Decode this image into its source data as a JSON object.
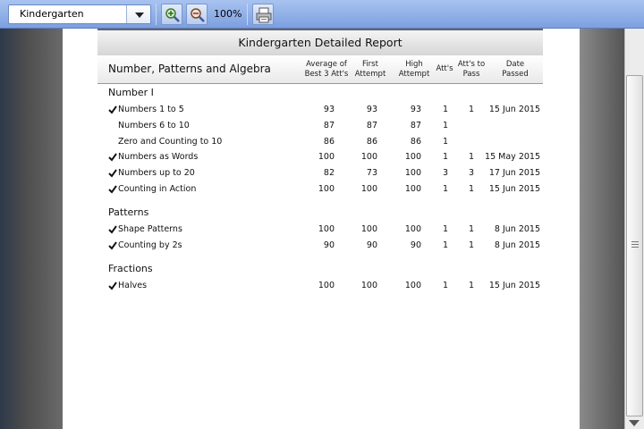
{
  "toolbar": {
    "dropdown_value": "Kindergarten",
    "zoom": "100%",
    "icons": {
      "zoom_in": "zoom-in-icon",
      "zoom_out": "zoom-out-icon",
      "print": "printer-icon"
    }
  },
  "report": {
    "title": "Kindergarten Detailed Report",
    "section": "Number, Patterns and Algebra",
    "columns": {
      "avg": "Average of Best 3 Att's",
      "first": "First Attempt",
      "high": "High Attempt",
      "atts": "Att's",
      "atts_to_pass": "Att's to Pass",
      "date_passed": "Date Passed"
    },
    "groups": [
      {
        "name": "Number I",
        "rows": [
          {
            "passed": true,
            "name": "Numbers 1 to 5",
            "avg": "93",
            "first": "93",
            "high": "93",
            "atts": "1",
            "to_pass": "1",
            "date": "15 Jun 2015"
          },
          {
            "passed": false,
            "name": "Numbers 6 to 10",
            "avg": "87",
            "first": "87",
            "high": "87",
            "atts": "1",
            "to_pass": "",
            "date": ""
          },
          {
            "passed": false,
            "name": "Zero and Counting to 10",
            "avg": "86",
            "first": "86",
            "high": "86",
            "atts": "1",
            "to_pass": "",
            "date": ""
          },
          {
            "passed": true,
            "name": "Numbers as Words",
            "avg": "100",
            "first": "100",
            "high": "100",
            "atts": "1",
            "to_pass": "1",
            "date": "15 May 2015"
          },
          {
            "passed": true,
            "name": "Numbers up to 20",
            "avg": "82",
            "first": "73",
            "high": "100",
            "atts": "3",
            "to_pass": "3",
            "date": "17 Jun 2015"
          },
          {
            "passed": true,
            "name": "Counting in Action",
            "avg": "100",
            "first": "100",
            "high": "100",
            "atts": "1",
            "to_pass": "1",
            "date": "15 Jun 2015"
          }
        ]
      },
      {
        "name": "Patterns",
        "rows": [
          {
            "passed": true,
            "name": "Shape Patterns",
            "avg": "100",
            "first": "100",
            "high": "100",
            "atts": "1",
            "to_pass": "1",
            "date": "8 Jun 2015"
          },
          {
            "passed": true,
            "name": "Counting by 2s",
            "avg": "90",
            "first": "90",
            "high": "90",
            "atts": "1",
            "to_pass": "1",
            "date": "8 Jun 2015"
          }
        ]
      },
      {
        "name": "Fractions",
        "rows": [
          {
            "passed": true,
            "name": "Halves",
            "avg": "100",
            "first": "100",
            "high": "100",
            "atts": "1",
            "to_pass": "1",
            "date": "15 Jun 2015"
          }
        ]
      }
    ]
  },
  "colors": {
    "toolbar": "#8fb0ea",
    "check": "#111111"
  }
}
